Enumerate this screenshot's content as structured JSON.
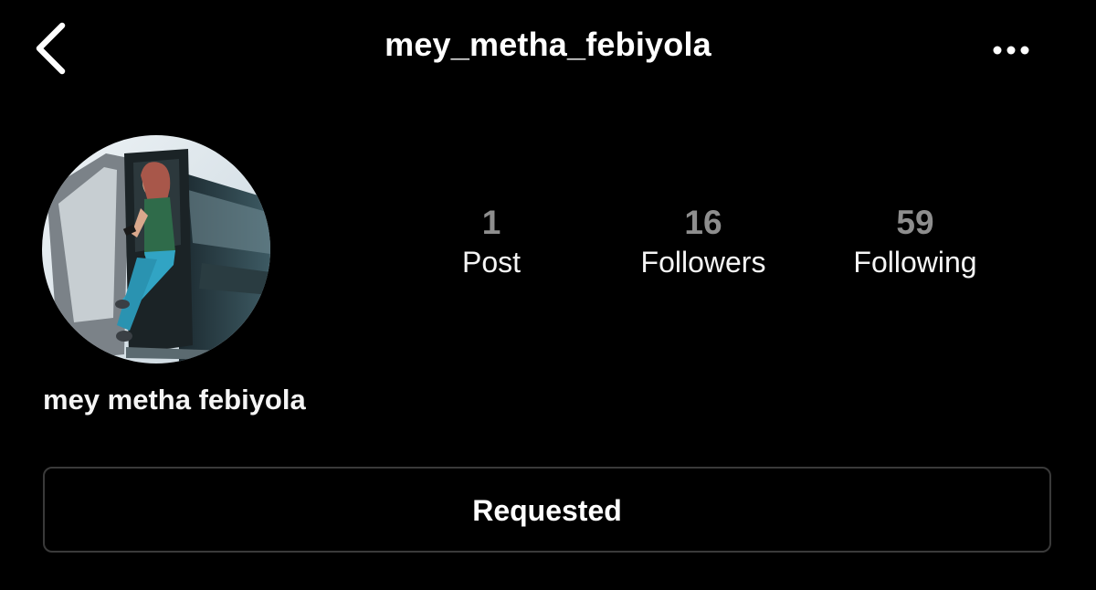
{
  "header": {
    "username": "mey_metha_febiyola",
    "back_icon": "chevron-left-icon",
    "more_icon": "ellipsis-horizontal-icon"
  },
  "profile": {
    "display_name": "mey metha febiyola",
    "avatar_description": "profile-photo"
  },
  "stats": [
    {
      "count": "1",
      "label": "Post"
    },
    {
      "count": "16",
      "label": "Followers"
    },
    {
      "count": "59",
      "label": "Following"
    }
  ],
  "actions": {
    "follow_status_label": "Requested"
  },
  "colors": {
    "background": "#000000",
    "text": "#ffffff",
    "stat_count": "#8e8e8e",
    "button_border": "#3a3a3a"
  }
}
